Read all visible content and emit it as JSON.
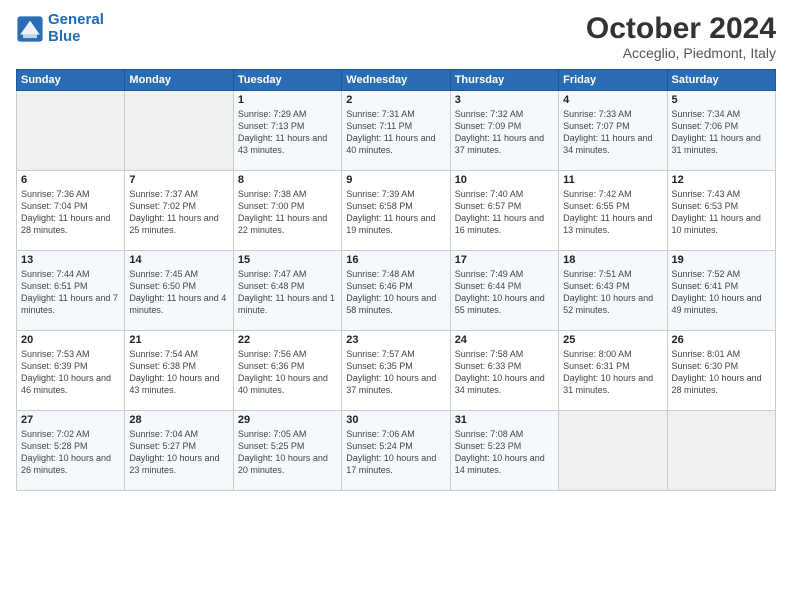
{
  "logo": {
    "line1": "General",
    "line2": "Blue"
  },
  "title": "October 2024",
  "subtitle": "Acceglio, Piedmont, Italy",
  "header_days": [
    "Sunday",
    "Monday",
    "Tuesday",
    "Wednesday",
    "Thursday",
    "Friday",
    "Saturday"
  ],
  "weeks": [
    [
      {
        "day": "",
        "info": ""
      },
      {
        "day": "",
        "info": ""
      },
      {
        "day": "1",
        "info": "Sunrise: 7:29 AM\nSunset: 7:13 PM\nDaylight: 11 hours and 43 minutes."
      },
      {
        "day": "2",
        "info": "Sunrise: 7:31 AM\nSunset: 7:11 PM\nDaylight: 11 hours and 40 minutes."
      },
      {
        "day": "3",
        "info": "Sunrise: 7:32 AM\nSunset: 7:09 PM\nDaylight: 11 hours and 37 minutes."
      },
      {
        "day": "4",
        "info": "Sunrise: 7:33 AM\nSunset: 7:07 PM\nDaylight: 11 hours and 34 minutes."
      },
      {
        "day": "5",
        "info": "Sunrise: 7:34 AM\nSunset: 7:06 PM\nDaylight: 11 hours and 31 minutes."
      }
    ],
    [
      {
        "day": "6",
        "info": "Sunrise: 7:36 AM\nSunset: 7:04 PM\nDaylight: 11 hours and 28 minutes."
      },
      {
        "day": "7",
        "info": "Sunrise: 7:37 AM\nSunset: 7:02 PM\nDaylight: 11 hours and 25 minutes."
      },
      {
        "day": "8",
        "info": "Sunrise: 7:38 AM\nSunset: 7:00 PM\nDaylight: 11 hours and 22 minutes."
      },
      {
        "day": "9",
        "info": "Sunrise: 7:39 AM\nSunset: 6:58 PM\nDaylight: 11 hours and 19 minutes."
      },
      {
        "day": "10",
        "info": "Sunrise: 7:40 AM\nSunset: 6:57 PM\nDaylight: 11 hours and 16 minutes."
      },
      {
        "day": "11",
        "info": "Sunrise: 7:42 AM\nSunset: 6:55 PM\nDaylight: 11 hours and 13 minutes."
      },
      {
        "day": "12",
        "info": "Sunrise: 7:43 AM\nSunset: 6:53 PM\nDaylight: 11 hours and 10 minutes."
      }
    ],
    [
      {
        "day": "13",
        "info": "Sunrise: 7:44 AM\nSunset: 6:51 PM\nDaylight: 11 hours and 7 minutes."
      },
      {
        "day": "14",
        "info": "Sunrise: 7:45 AM\nSunset: 6:50 PM\nDaylight: 11 hours and 4 minutes."
      },
      {
        "day": "15",
        "info": "Sunrise: 7:47 AM\nSunset: 6:48 PM\nDaylight: 11 hours and 1 minute."
      },
      {
        "day": "16",
        "info": "Sunrise: 7:48 AM\nSunset: 6:46 PM\nDaylight: 10 hours and 58 minutes."
      },
      {
        "day": "17",
        "info": "Sunrise: 7:49 AM\nSunset: 6:44 PM\nDaylight: 10 hours and 55 minutes."
      },
      {
        "day": "18",
        "info": "Sunrise: 7:51 AM\nSunset: 6:43 PM\nDaylight: 10 hours and 52 minutes."
      },
      {
        "day": "19",
        "info": "Sunrise: 7:52 AM\nSunset: 6:41 PM\nDaylight: 10 hours and 49 minutes."
      }
    ],
    [
      {
        "day": "20",
        "info": "Sunrise: 7:53 AM\nSunset: 6:39 PM\nDaylight: 10 hours and 46 minutes."
      },
      {
        "day": "21",
        "info": "Sunrise: 7:54 AM\nSunset: 6:38 PM\nDaylight: 10 hours and 43 minutes."
      },
      {
        "day": "22",
        "info": "Sunrise: 7:56 AM\nSunset: 6:36 PM\nDaylight: 10 hours and 40 minutes."
      },
      {
        "day": "23",
        "info": "Sunrise: 7:57 AM\nSunset: 6:35 PM\nDaylight: 10 hours and 37 minutes."
      },
      {
        "day": "24",
        "info": "Sunrise: 7:58 AM\nSunset: 6:33 PM\nDaylight: 10 hours and 34 minutes."
      },
      {
        "day": "25",
        "info": "Sunrise: 8:00 AM\nSunset: 6:31 PM\nDaylight: 10 hours and 31 minutes."
      },
      {
        "day": "26",
        "info": "Sunrise: 8:01 AM\nSunset: 6:30 PM\nDaylight: 10 hours and 28 minutes."
      }
    ],
    [
      {
        "day": "27",
        "info": "Sunrise: 7:02 AM\nSunset: 5:28 PM\nDaylight: 10 hours and 26 minutes."
      },
      {
        "day": "28",
        "info": "Sunrise: 7:04 AM\nSunset: 5:27 PM\nDaylight: 10 hours and 23 minutes."
      },
      {
        "day": "29",
        "info": "Sunrise: 7:05 AM\nSunset: 5:25 PM\nDaylight: 10 hours and 20 minutes."
      },
      {
        "day": "30",
        "info": "Sunrise: 7:06 AM\nSunset: 5:24 PM\nDaylight: 10 hours and 17 minutes."
      },
      {
        "day": "31",
        "info": "Sunrise: 7:08 AM\nSunset: 5:23 PM\nDaylight: 10 hours and 14 minutes."
      },
      {
        "day": "",
        "info": ""
      },
      {
        "day": "",
        "info": ""
      }
    ]
  ]
}
